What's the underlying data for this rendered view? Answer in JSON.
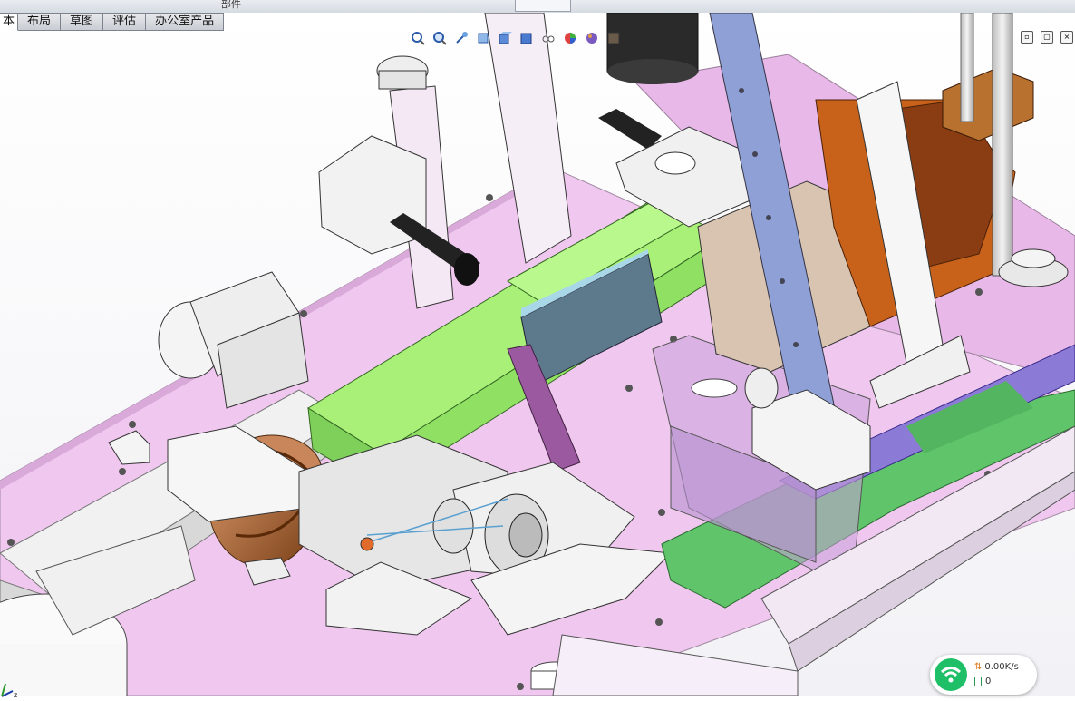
{
  "ribbon": {
    "top_tabs": [
      "部件"
    ]
  },
  "tabs": [
    {
      "label": "本",
      "active": true
    },
    {
      "label": "布局",
      "active": false
    },
    {
      "label": "草图",
      "active": false
    },
    {
      "label": "评估",
      "active": false
    },
    {
      "label": "办公室产品",
      "active": false
    }
  ],
  "headsup_toolbar": {
    "icons": [
      "zoom-to-fit-icon",
      "zoom-to-area-icon",
      "previous-view-icon",
      "section-view-icon",
      "view-orientation-icon",
      "display-style-icon",
      "hide-show-items-icon",
      "edit-appearance-icon",
      "apply-scene-icon",
      "view-settings-icon"
    ]
  },
  "window_controls": {
    "icons": [
      "tile-icon",
      "restore-icon",
      "close-icon"
    ]
  },
  "triad": {
    "axis": "z"
  },
  "network_widget": {
    "speed": "0.00K/s",
    "count": "0",
    "colors": {
      "wifi": "#1fbf67",
      "arrows": "#e07a1a"
    }
  },
  "model_colors": {
    "plate": "#f0c8ef",
    "green": "#9ee86e",
    "blue": "#8ea0d6",
    "orange": "#c8621a",
    "brown": "#b8712f",
    "grey": "#d7d7d7",
    "purple": "#9b5aa0"
  }
}
